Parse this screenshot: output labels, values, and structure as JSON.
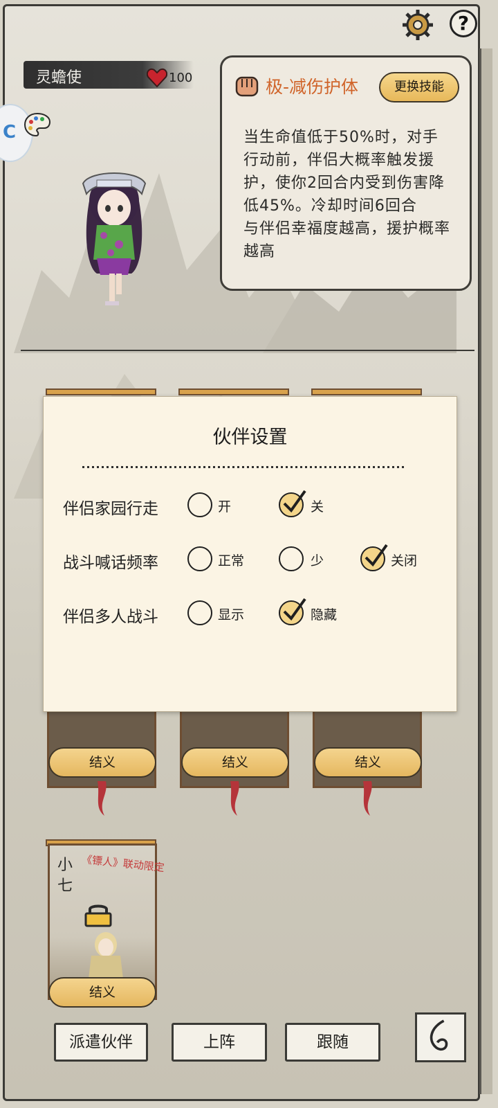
{
  "header": {
    "companion_name": "灵蟾使",
    "hp_value": "100",
    "side_badge_text": "C"
  },
  "skill": {
    "name": "极-减伤护体",
    "change_button": "更换技能",
    "description": "当生命值低于50%时，对手行动前，伴侣大概率触发援护，使你2回合内受到伤害降低45%。冷却时间6回合\n与伴侣幸福度越高，援护概率越高"
  },
  "cards": [
    {
      "button": "结义"
    },
    {
      "button": "结义"
    },
    {
      "button": "结义"
    },
    {
      "name": "小七",
      "tag": "《镖人》联动限定",
      "button": "结义"
    }
  ],
  "bottom_bar": {
    "dispatch": "派遣伙伴",
    "deploy": "上阵",
    "follow": "跟随"
  },
  "dialog": {
    "title": "伙伴设置",
    "rows": [
      {
        "label": "伴侣家园行走",
        "options": [
          "开",
          "关"
        ],
        "selected": "关"
      },
      {
        "label": "战斗喊话频率",
        "options": [
          "正常",
          "少",
          "关闭"
        ],
        "selected": "关闭"
      },
      {
        "label": "伴侣多人战斗",
        "options": [
          "显示",
          "隐藏"
        ],
        "selected": "隐藏"
      }
    ]
  },
  "colors": {
    "skill_name": "#d0642a",
    "button_gold": "#e7b85a",
    "collab_red": "#c43a3a",
    "dialog_bg": "#fbf4e4"
  }
}
